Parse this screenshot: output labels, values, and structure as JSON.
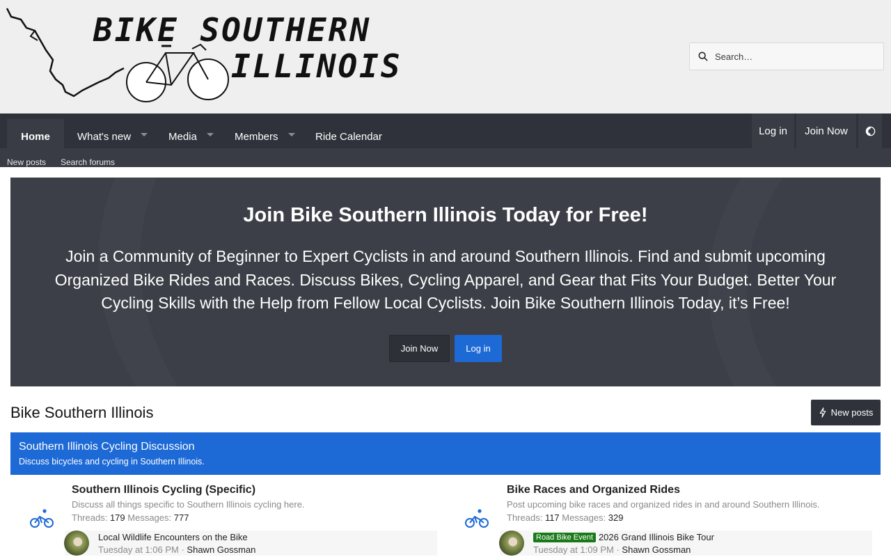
{
  "header": {
    "logo_line1": "BIKE SOUTHERN",
    "logo_line2": "ILLINOIS",
    "search_placeholder": "Search…"
  },
  "nav": {
    "items": [
      {
        "label": "Home"
      },
      {
        "label": "What's new"
      },
      {
        "label": "Media"
      },
      {
        "label": "Members"
      },
      {
        "label": "Ride Calendar"
      }
    ],
    "login": "Log in",
    "join": "Join Now",
    "sub_items": [
      "New posts",
      "Search forums"
    ]
  },
  "notice": {
    "title": "Join Bike Southern Illinois Today for Free!",
    "body": "Join a Community of Beginner to Expert Cyclists in and around Southern Illinois. Find and submit upcoming Organized Bike Rides and Races. Discuss Bikes, Cycling Apparel, and Gear that Fits Your Budget. Better Your Cycling Skills with the Help from Fellow Local Cyclists. Join Bike Southern Illinois Today, it’s Free!",
    "join_label": "Join Now",
    "login_label": "Log in"
  },
  "page": {
    "title": "Bike Southern Illinois",
    "new_posts_label": "New posts"
  },
  "category": {
    "title": "Southern Illinois Cycling Discussion",
    "description": "Discuss bicycles and cycling in Southern Illinois."
  },
  "forums": [
    {
      "title": "Southern Illinois Cycling (Specific)",
      "description": "Discuss all things specific to Southern Illinois cycling here.",
      "threads_label": "Threads:",
      "threads": "179",
      "messages_label": "Messages:",
      "messages": "777",
      "latest": {
        "prefix": "",
        "title": "Local Wildlife Encounters on the Bike",
        "time": "Tuesday at 1:06 PM",
        "user": "Shawn Gossman"
      }
    },
    {
      "title": "Bike Races and Organized Rides",
      "description": "Post upcoming bike races and organized rides in and around Southern Illinois.",
      "threads_label": "Threads:",
      "threads": "117",
      "messages_label": "Messages:",
      "messages": "329",
      "latest": {
        "prefix": "Road Bike Event",
        "title": "2026 Grand Illinois Bike Tour",
        "time": "Tuesday at 1:09 PM",
        "user": "Shawn Gossman"
      }
    }
  ],
  "colors": {
    "accent": "#1d6ad6",
    "nav_bg": "#2f323a",
    "prefix_green": "#1a7a1a"
  }
}
